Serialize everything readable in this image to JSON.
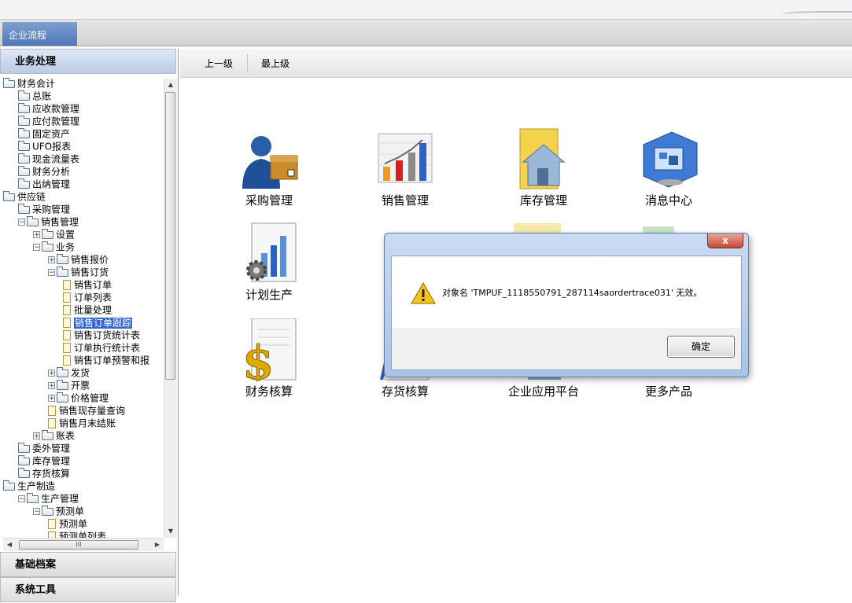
{
  "header": {
    "tab_label": "企业流程"
  },
  "left_panel": {
    "active_section": "业务处理",
    "sections_bottom": [
      "基础档案",
      "系统工具"
    ],
    "scroll_h_grip": "III",
    "tree": [
      {
        "label": "财务会计",
        "indent": 0,
        "exp": "",
        "icon": "folder"
      },
      {
        "label": "总账",
        "indent": 1,
        "exp": "",
        "icon": "folder"
      },
      {
        "label": "应收款管理",
        "indent": 1,
        "exp": "",
        "icon": "folder"
      },
      {
        "label": "应付款管理",
        "indent": 1,
        "exp": "",
        "icon": "folder"
      },
      {
        "label": "固定资产",
        "indent": 1,
        "exp": "",
        "icon": "folder"
      },
      {
        "label": "UFO报表",
        "indent": 1,
        "exp": "",
        "icon": "folder"
      },
      {
        "label": "现金流量表",
        "indent": 1,
        "exp": "",
        "icon": "folder"
      },
      {
        "label": "财务分析",
        "indent": 1,
        "exp": "",
        "icon": "folder"
      },
      {
        "label": "出纳管理",
        "indent": 1,
        "exp": "",
        "icon": "folder"
      },
      {
        "label": "供应链",
        "indent": 0,
        "exp": "",
        "icon": "folder"
      },
      {
        "label": "采购管理",
        "indent": 1,
        "exp": "",
        "icon": "folder"
      },
      {
        "label": "销售管理",
        "indent": 1,
        "exp": "-",
        "icon": "folder"
      },
      {
        "label": "设置",
        "indent": 2,
        "exp": "+",
        "icon": "folder"
      },
      {
        "label": "业务",
        "indent": 2,
        "exp": "-",
        "icon": "folder"
      },
      {
        "label": "销售报价",
        "indent": 3,
        "exp": "+",
        "icon": "folder"
      },
      {
        "label": "销售订货",
        "indent": 3,
        "exp": "-",
        "icon": "folder"
      },
      {
        "label": "销售订单",
        "indent": 4,
        "exp": "",
        "icon": "doc"
      },
      {
        "label": "订单列表",
        "indent": 4,
        "exp": "",
        "icon": "doc"
      },
      {
        "label": "批量处理",
        "indent": 4,
        "exp": "",
        "icon": "doc"
      },
      {
        "label": "销售订单跟踪",
        "indent": 4,
        "exp": "",
        "icon": "doc",
        "selected": true
      },
      {
        "label": "销售订货统计表",
        "indent": 4,
        "exp": "",
        "icon": "doc"
      },
      {
        "label": "订单执行统计表",
        "indent": 4,
        "exp": "",
        "icon": "doc"
      },
      {
        "label": "销售订单预警和报",
        "indent": 4,
        "exp": "",
        "icon": "doc"
      },
      {
        "label": "发货",
        "indent": 3,
        "exp": "+",
        "icon": "folder"
      },
      {
        "label": "开票",
        "indent": 3,
        "exp": "+",
        "icon": "folder"
      },
      {
        "label": "价格管理",
        "indent": 3,
        "exp": "+",
        "icon": "folder"
      },
      {
        "label": "销售现存量查询",
        "indent": 3,
        "exp": "",
        "icon": "doc"
      },
      {
        "label": "销售月末结账",
        "indent": 3,
        "exp": "",
        "icon": "doc"
      },
      {
        "label": "账表",
        "indent": 2,
        "exp": "+",
        "icon": "folder"
      },
      {
        "label": "委外管理",
        "indent": 1,
        "exp": "",
        "icon": "folder"
      },
      {
        "label": "库存管理",
        "indent": 1,
        "exp": "",
        "icon": "folder"
      },
      {
        "label": "存货核算",
        "indent": 1,
        "exp": "",
        "icon": "folder"
      },
      {
        "label": "生产制造",
        "indent": 0,
        "exp": "",
        "icon": "folder"
      },
      {
        "label": "生产管理",
        "indent": 1,
        "exp": "-",
        "icon": "folder"
      },
      {
        "label": "预测单",
        "indent": 2,
        "exp": "-",
        "icon": "folder"
      },
      {
        "label": "预测单",
        "indent": 3,
        "exp": "",
        "icon": "doc"
      },
      {
        "label": "预测单列表",
        "indent": 3,
        "exp": "",
        "icon": "doc"
      }
    ]
  },
  "toolbar": {
    "up_label": "上一级",
    "top_label": "最上级"
  },
  "apps": [
    {
      "label": "采购管理",
      "icon": "purchase-icon"
    },
    {
      "label": "销售管理",
      "icon": "sales-chart-icon"
    },
    {
      "label": "库存管理",
      "icon": "inventory-house-icon"
    },
    {
      "label": "消息中心",
      "icon": "message-monitor-icon"
    },
    {
      "label": "计划生产",
      "icon": "plan-production-icon"
    },
    {
      "label": "财务核算",
      "icon": "finance-dollar-icon"
    },
    {
      "label": "存货核算",
      "icon": "stock-accounting-icon"
    },
    {
      "label": "企业应用平台",
      "icon": "platform-icon"
    },
    {
      "label": "更多产品",
      "icon": "more-products-icon"
    }
  ],
  "dialog": {
    "message": "对象名 'TMPUF_1118550791_287114saordertrace031' 无效。",
    "ok_label": "确定",
    "close_label": "x"
  },
  "colors": {
    "accent": "#4f78b8",
    "selection": "#3366cc",
    "dialog_frame": "#a9c3e6"
  }
}
